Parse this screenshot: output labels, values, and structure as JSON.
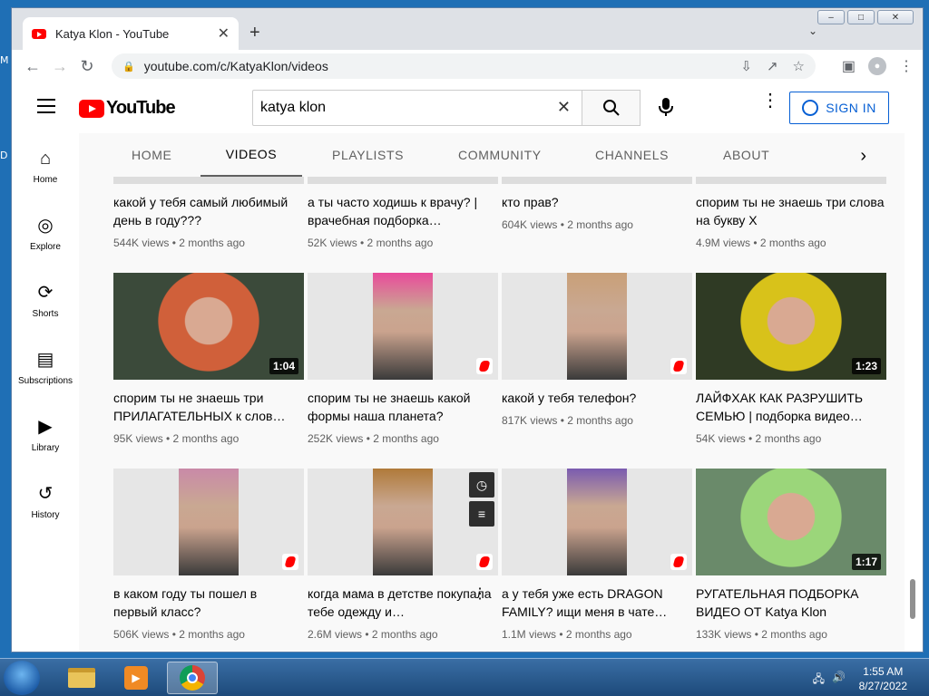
{
  "desktop": {
    "left_labels": [
      "M",
      "D"
    ]
  },
  "window": {
    "controls": {
      "minimize": "–",
      "maximize": "□",
      "close": "✕"
    }
  },
  "browser": {
    "tab_title": "Katya Klon - YouTube",
    "tab_close": "✕",
    "new_tab": "+",
    "tab_dropdown": "⌄",
    "back": "←",
    "forward": "→",
    "reload": "↻",
    "lock": "🔒",
    "url": "youtube.com/c/KatyaKlon/videos",
    "menu": "⋮"
  },
  "youtube": {
    "logo_text": "YouTube",
    "search_value": "katya klon",
    "search_clear": "✕",
    "signin_label": "SIGN IN",
    "kebab": "⋮"
  },
  "rail": [
    {
      "label": "Home",
      "icon": "home-icon",
      "glyph": "⌂"
    },
    {
      "label": "Explore",
      "icon": "explore-icon",
      "glyph": "◎"
    },
    {
      "label": "Shorts",
      "icon": "shorts-icon",
      "glyph": "⟳"
    },
    {
      "label": "Subscriptions",
      "icon": "subscriptions-icon",
      "glyph": "▤"
    },
    {
      "label": "Library",
      "icon": "library-icon",
      "glyph": "▶"
    },
    {
      "label": "History",
      "icon": "history-icon",
      "glyph": "↺"
    }
  ],
  "channel_tabs": [
    "HOME",
    "VIDEOS",
    "PLAYLISTS",
    "COMMUNITY",
    "CHANNELS",
    "ABOUT"
  ],
  "channel_tabs_active": "VIDEOS",
  "tabs_next": "›",
  "rows": [
    [
      {
        "title": "какой у тебя самый любимый день в году???",
        "meta": "544K views • 2 months ago"
      },
      {
        "title": "а ты часто ходишь к врачу? | врачебная подборка…",
        "meta": "52K views • 2 months ago"
      },
      {
        "title": "кто прав?",
        "meta": "604K views • 2 months ago"
      },
      {
        "title": "спорим ты не знаешь три слова на букву Х",
        "meta": "4.9M views • 2 months ago"
      }
    ],
    [
      {
        "title": "спорим ты не знаешь три ПРИЛАГАТЕЛЬНЫХ к слов…",
        "meta": "95K views • 2 months ago",
        "duration": "1:04",
        "bg": "#3b4a3a",
        "accent": "#d0603a"
      },
      {
        "title": "спорим ты не знаешь какой формы наша планета?",
        "meta": "252K views • 2 months ago",
        "shorts": true,
        "bg": "#e6e6e6",
        "accent": "#e94b9b"
      },
      {
        "title": "какой у тебя телефон?",
        "meta": "817K views • 2 months ago",
        "shorts": true,
        "bg": "#e6e6e6",
        "accent": "#c9a078"
      },
      {
        "title": "ЛАЙФХАК КАК РАЗРУШИТЬ СЕМЬЮ | подборка видео…",
        "meta": "54K views • 2 months ago",
        "duration": "1:23",
        "bg": "#2f3a24",
        "accent": "#d8c21a"
      }
    ],
    [
      {
        "title": "в каком году ты пошел в первый класс?",
        "meta": "506K views • 2 months ago",
        "shorts": true,
        "bg": "#e6e6e6",
        "accent": "#c98aa8"
      },
      {
        "title": "когда мама в детстве покупала тебе одежду и…",
        "meta": "2.6M views • 2 months ago",
        "shorts": true,
        "hover": true,
        "bg": "#e6e6e6",
        "accent": "#b07a3a"
      },
      {
        "title": "а у тебя уже есть DRAGON FAMILY? ищи меня в чате…",
        "meta": "1.1M views • 2 months ago",
        "shorts": true,
        "bg": "#e6e6e6",
        "accent": "#7a5bb0"
      },
      {
        "title": "РУГАТЕЛЬНАЯ ПОДБОРКА ВИДЕО ОТ Katya Klon",
        "meta": "133K views • 2 months ago",
        "duration": "1:17",
        "bg": "#6a8a6a",
        "accent": "#9bd67a"
      }
    ]
  ],
  "hover_actions": {
    "watch_later": "◷",
    "add_to_queue": "≡"
  },
  "video_menu": "⋮",
  "taskbar": {
    "time": "1:55 AM",
    "date": "8/27/2022"
  }
}
